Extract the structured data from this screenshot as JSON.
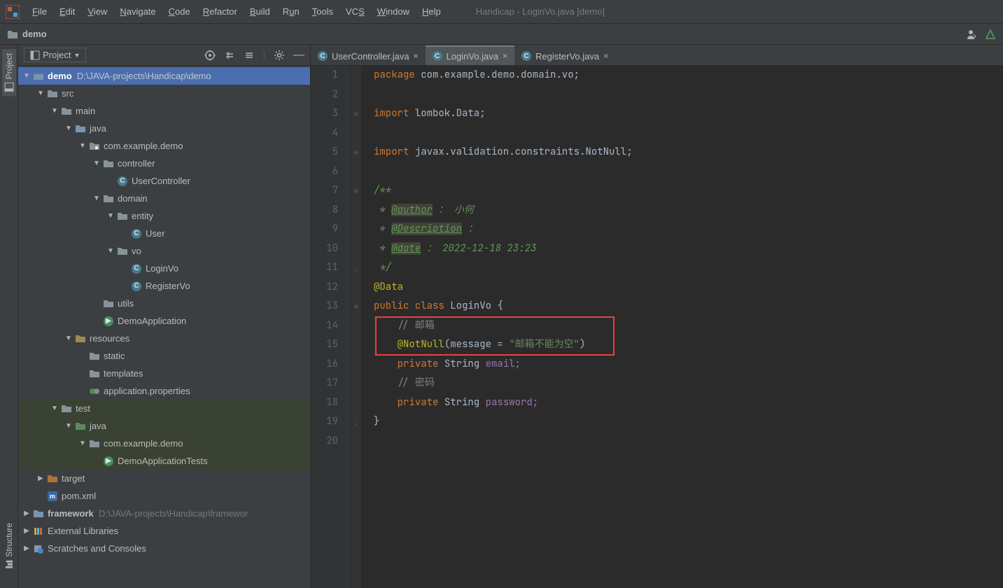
{
  "menubar": [
    "File",
    "Edit",
    "View",
    "Navigate",
    "Code",
    "Refactor",
    "Build",
    "Run",
    "Tools",
    "VCS",
    "Window",
    "Help"
  ],
  "window_title": "Handicap - LoginVo.java [demo]",
  "breadcrumb": "demo",
  "sidebar": {
    "project": "Project",
    "structure": "Structure"
  },
  "panel": {
    "title": "Project"
  },
  "tree": {
    "root": {
      "name": "demo",
      "path": "D:\\JAVA-projects\\Handicap\\demo"
    },
    "src": "src",
    "main": "main",
    "java": "java",
    "pkg": "com.example.demo",
    "controller": "controller",
    "usercontroller": "UserController",
    "domain": "domain",
    "entity": "entity",
    "user": "User",
    "vo": "vo",
    "loginvo": "LoginVo",
    "registervo": "RegisterVo",
    "utils": "utils",
    "demoapp": "DemoApplication",
    "resources": "resources",
    "static": "static",
    "templates": "templates",
    "appprops": "application.properties",
    "test": "test",
    "testjava": "java",
    "testpkg": "com.example.demo",
    "demotests": "DemoApplicationTests",
    "target": "target",
    "pom": "pom.xml",
    "framework": {
      "name": "framework",
      "path": "D:\\JAVA-projects\\Handicap\\framewor"
    },
    "extlib": "External Libraries",
    "scratches": "Scratches and Consoles"
  },
  "tabs": [
    {
      "label": "UserController.java",
      "active": false
    },
    {
      "label": "LoginVo.java",
      "active": true
    },
    {
      "label": "RegisterVo.java",
      "active": false
    }
  ],
  "code": {
    "line_count": 20,
    "l1": {
      "a": "package ",
      "b": "com.example.demo.domain.vo;"
    },
    "l3": {
      "a": "import ",
      "b": "lombok.Data;"
    },
    "l5": {
      "a": "import ",
      "b": "javax.validation.constraints.NotNull;"
    },
    "l7": "/**",
    "l8": {
      "a": " * ",
      "b": "@author",
      "c": " ：",
      "d": " 小何"
    },
    "l9": {
      "a": " * ",
      "b": "@Description",
      "c": " ："
    },
    "l10": {
      "a": " * ",
      "b": "@date",
      "c": " ： 2022-12-18 23:23"
    },
    "l11": " */",
    "l12": "@Data",
    "l13": {
      "a": "public class ",
      "b": "LoginVo ",
      "c": "{"
    },
    "l14": "    // 邮箱",
    "l15": {
      "a": "    ",
      "b": "@NotNull",
      "c": "(message = ",
      "d": "\"邮箱不能为空\"",
      "e": ")"
    },
    "l16": {
      "a": "    ",
      "b": "private ",
      "c": "String ",
      "d": "email;"
    },
    "l17": "    // 密码",
    "l18": {
      "a": "    ",
      "b": "private ",
      "c": "String ",
      "d": "password;"
    },
    "l19": "}"
  }
}
